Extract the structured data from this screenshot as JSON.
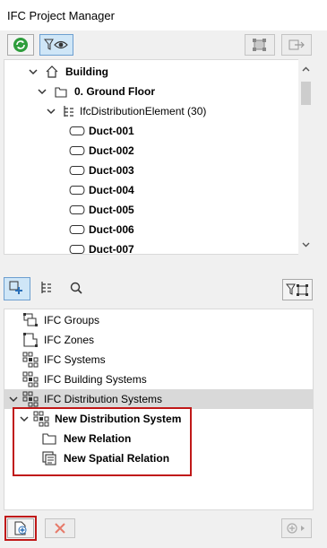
{
  "window": {
    "title": "IFC Project Manager"
  },
  "top_toolbar": {
    "refresh_icon": "refresh-icon",
    "filter_view_icon": "filter-eye-icon",
    "right_icons": [
      "element-select-icon",
      "move-to-icon"
    ]
  },
  "model_tree": {
    "items": [
      {
        "label": "Building",
        "bold": true,
        "icon": "building-icon"
      },
      {
        "label": "0. Ground Floor",
        "bold": true,
        "icon": "folder-icon"
      },
      {
        "label": "IfcDistributionElement (30)",
        "bold": false,
        "icon": "type-tree-icon"
      },
      {
        "label": "Duct-001",
        "bold": true,
        "icon": "duct-icon"
      },
      {
        "label": "Duct-002",
        "bold": true,
        "icon": "duct-icon"
      },
      {
        "label": "Duct-003",
        "bold": true,
        "icon": "duct-icon"
      },
      {
        "label": "Duct-004",
        "bold": true,
        "icon": "duct-icon"
      },
      {
        "label": "Duct-005",
        "bold": true,
        "icon": "duct-icon"
      },
      {
        "label": "Duct-006",
        "bold": true,
        "icon": "duct-icon"
      },
      {
        "label": "Duct-007",
        "bold": true,
        "icon": "duct-icon"
      }
    ]
  },
  "mid_toolbar": {
    "tabs": [
      "assignments-icon",
      "type-tree-icon",
      "search-icon"
    ],
    "right_icon": "filter-element-icon"
  },
  "assignments_tree": {
    "items": [
      {
        "label": "IFC Groups",
        "bold": false,
        "icon": "groups-icon"
      },
      {
        "label": "IFC Zones",
        "bold": false,
        "icon": "zones-icon"
      },
      {
        "label": "IFC Systems",
        "bold": false,
        "icon": "systems-icon"
      },
      {
        "label": "IFC Building Systems",
        "bold": false,
        "icon": "systems-icon"
      },
      {
        "label": "IFC Distribution Systems",
        "bold": false,
        "icon": "systems-icon"
      },
      {
        "label": "New Distribution System",
        "bold": true,
        "icon": "systems-icon"
      },
      {
        "label": "New Relation",
        "bold": true,
        "icon": "folder-icon"
      },
      {
        "label": "New Spatial Relation",
        "bold": true,
        "icon": "spatial-relation-icon"
      }
    ]
  },
  "bottom_toolbar": {
    "new_icon": "new-assignment-icon",
    "delete_icon": "delete-icon",
    "more_icon": "add-to-icon"
  },
  "colors": {
    "accent_green": "#2e9d3c",
    "selection_blue": "#cfe6f7",
    "highlight_red": "#c01818",
    "delete_red": "#e67a6a"
  }
}
